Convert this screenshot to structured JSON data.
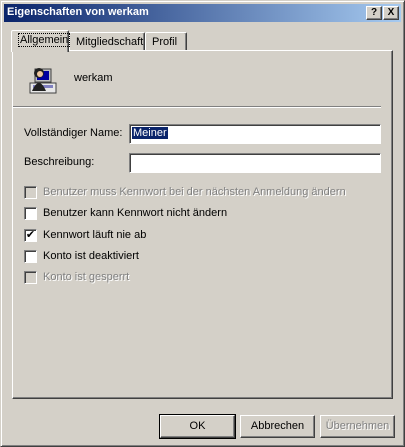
{
  "window": {
    "title": "Eigenschaften von werkam",
    "help_button": "?",
    "close_button": "X"
  },
  "tabs": [
    {
      "label": "Allgemein",
      "active": true
    },
    {
      "label": "Mitgliedschaft",
      "active": false
    },
    {
      "label": "Profil",
      "active": false
    }
  ],
  "user": {
    "name": "werkam",
    "icon": "user-icon"
  },
  "form": {
    "fullname_label": "Vollständiger Name:",
    "fullname_value": "Meiner",
    "description_label": "Beschreibung:",
    "description_value": ""
  },
  "options": [
    {
      "label": "Benutzer muss Kennwort bei der nächsten Anmeldung ändern",
      "checked": false,
      "enabled": false
    },
    {
      "label": "Benutzer kann Kennwort nicht ändern",
      "checked": false,
      "enabled": true
    },
    {
      "label": "Kennwort läuft nie ab",
      "checked": true,
      "enabled": true
    },
    {
      "label": "Konto ist deaktiviert",
      "checked": false,
      "enabled": true
    },
    {
      "label": "Konto ist gesperrt",
      "checked": false,
      "enabled": false
    }
  ],
  "buttons": {
    "ok": "OK",
    "cancel": "Abbrechen",
    "apply": "Übernehmen"
  },
  "colors": {
    "titlebar_start": "#0a246a",
    "titlebar_end": "#a6caf0",
    "face": "#d4d0c8"
  }
}
